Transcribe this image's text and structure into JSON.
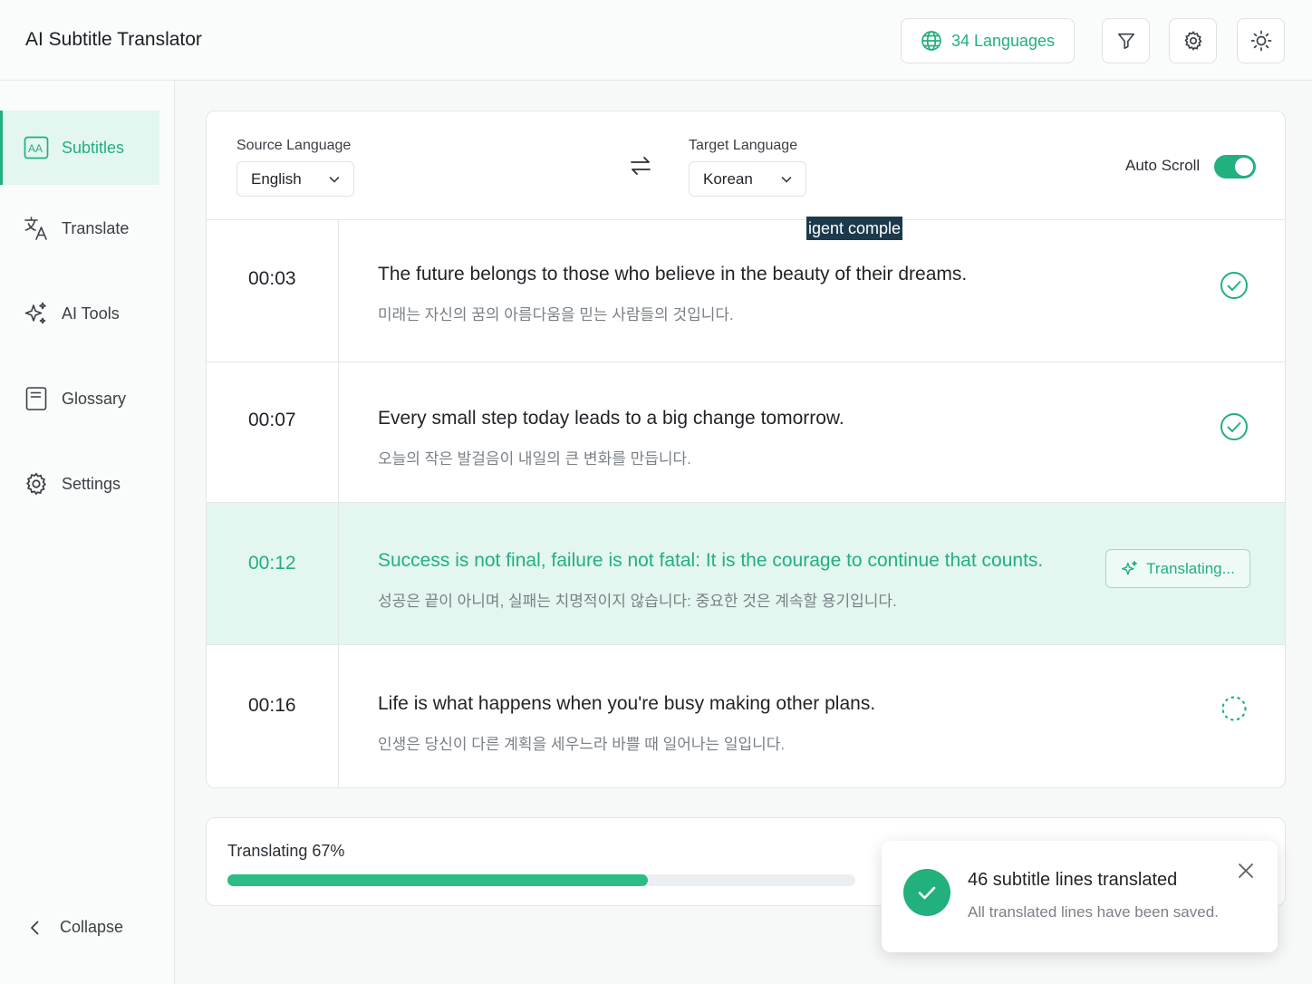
{
  "app": {
    "title": "AI Subtitle Translator"
  },
  "header": {
    "languages_label": "34 Languages",
    "icons": [
      "globe-icon",
      "filter-icon",
      "gear-icon",
      "sun-icon"
    ]
  },
  "sidebar": {
    "items": [
      {
        "label": "Subtitles",
        "icon": "subtitles-icon",
        "active": true
      },
      {
        "label": "Translate",
        "icon": "translate-icon",
        "active": false
      },
      {
        "label": "AI Tools",
        "icon": "sparkles-icon",
        "active": false
      },
      {
        "label": "Glossary",
        "icon": "book-icon",
        "active": false
      },
      {
        "label": "Settings",
        "icon": "gear-icon",
        "active": false
      }
    ],
    "collapse_label": "Collapse"
  },
  "controls": {
    "source_label": "Source Language",
    "source_value": "English",
    "target_label": "Target Language",
    "target_value": "Korean",
    "auto_scroll_label": "Auto Scroll",
    "auto_scroll_on": true,
    "overlay_fragment": "igent comple"
  },
  "subtitles": [
    {
      "time": "00:03",
      "source": "The future belongs to those who believe in the beauty of their dreams.",
      "target": "미래는 자신의 꿈의 아름다움을 믿는 사람들의 것입니다.",
      "status": "done"
    },
    {
      "time": "00:07",
      "source": "Every small step today leads to a big change tomorrow.",
      "target": "오늘의 작은 발걸음이 내일의 큰 변화를 만듭니다.",
      "status": "done"
    },
    {
      "time": "00:12",
      "source": "Success is not final, failure is not fatal: It is the courage to continue that counts.",
      "target": "성공은 끝이 아니며, 실패는 치명적이지 않습니다:  중요한 것은 계속할 용기입니다.",
      "status": "translating",
      "status_label": "Translating..."
    },
    {
      "time": "00:16",
      "source": "Life is what happens when you're busy making other plans.",
      "target": "인생은 당신이 다른 계획을 세우느라 바쁠 때 일어나는 일입니다.",
      "status": "pending"
    }
  ],
  "progress": {
    "label": "Translating 67%",
    "value": 0.67
  },
  "toast": {
    "title": "46 subtitle lines translated",
    "message": "All translated lines have been saved."
  },
  "colors": {
    "accent": "#22b07d",
    "active_row_bg": "#e3f6ef",
    "muted_text": "#7a8087"
  }
}
